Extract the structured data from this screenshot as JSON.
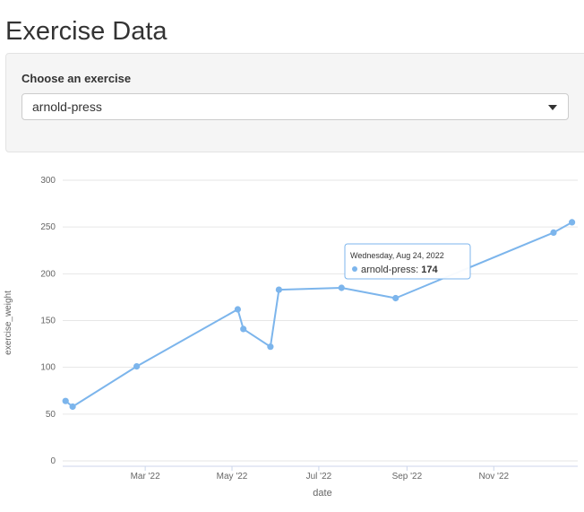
{
  "page": {
    "title": "Exercise Data"
  },
  "selector": {
    "label": "Choose an exercise",
    "value": "arnold-press"
  },
  "colors": {
    "series": "#7cb5ec",
    "grid": "#e6e6e6",
    "axis_text": "#666666"
  },
  "tooltip": {
    "date": "Wednesday, Aug 24, 2022",
    "series": "arnold-press",
    "value": "174"
  },
  "chart_data": {
    "type": "line",
    "xlabel": "date",
    "ylabel": "exercise_weight",
    "ylim": [
      0,
      300
    ],
    "xlim": [
      "2022-01-02",
      "2022-12-30"
    ],
    "grid": true,
    "y_ticks": [
      0,
      50,
      100,
      150,
      200,
      250,
      300
    ],
    "x_ticks": [
      {
        "date": "2022-03-01",
        "label": "Mar '22"
      },
      {
        "date": "2022-05-01",
        "label": "May '22"
      },
      {
        "date": "2022-07-01",
        "label": "Jul '22"
      },
      {
        "date": "2022-09-01",
        "label": "Sep '22"
      },
      {
        "date": "2022-11-01",
        "label": "Nov '22"
      }
    ],
    "series": [
      {
        "name": "arnold-press",
        "points": [
          {
            "x": "2022-01-04",
            "y": 64
          },
          {
            "x": "2022-01-09",
            "y": 58
          },
          {
            "x": "2022-02-23",
            "y": 101
          },
          {
            "x": "2022-05-05",
            "y": 162
          },
          {
            "x": "2022-05-09",
            "y": 141
          },
          {
            "x": "2022-05-28",
            "y": 122
          },
          {
            "x": "2022-06-03",
            "y": 183
          },
          {
            "x": "2022-07-17",
            "y": 185
          },
          {
            "x": "2022-08-24",
            "y": 174
          },
          {
            "x": "2022-12-13",
            "y": 244
          },
          {
            "x": "2022-12-26",
            "y": 255
          }
        ]
      }
    ]
  }
}
